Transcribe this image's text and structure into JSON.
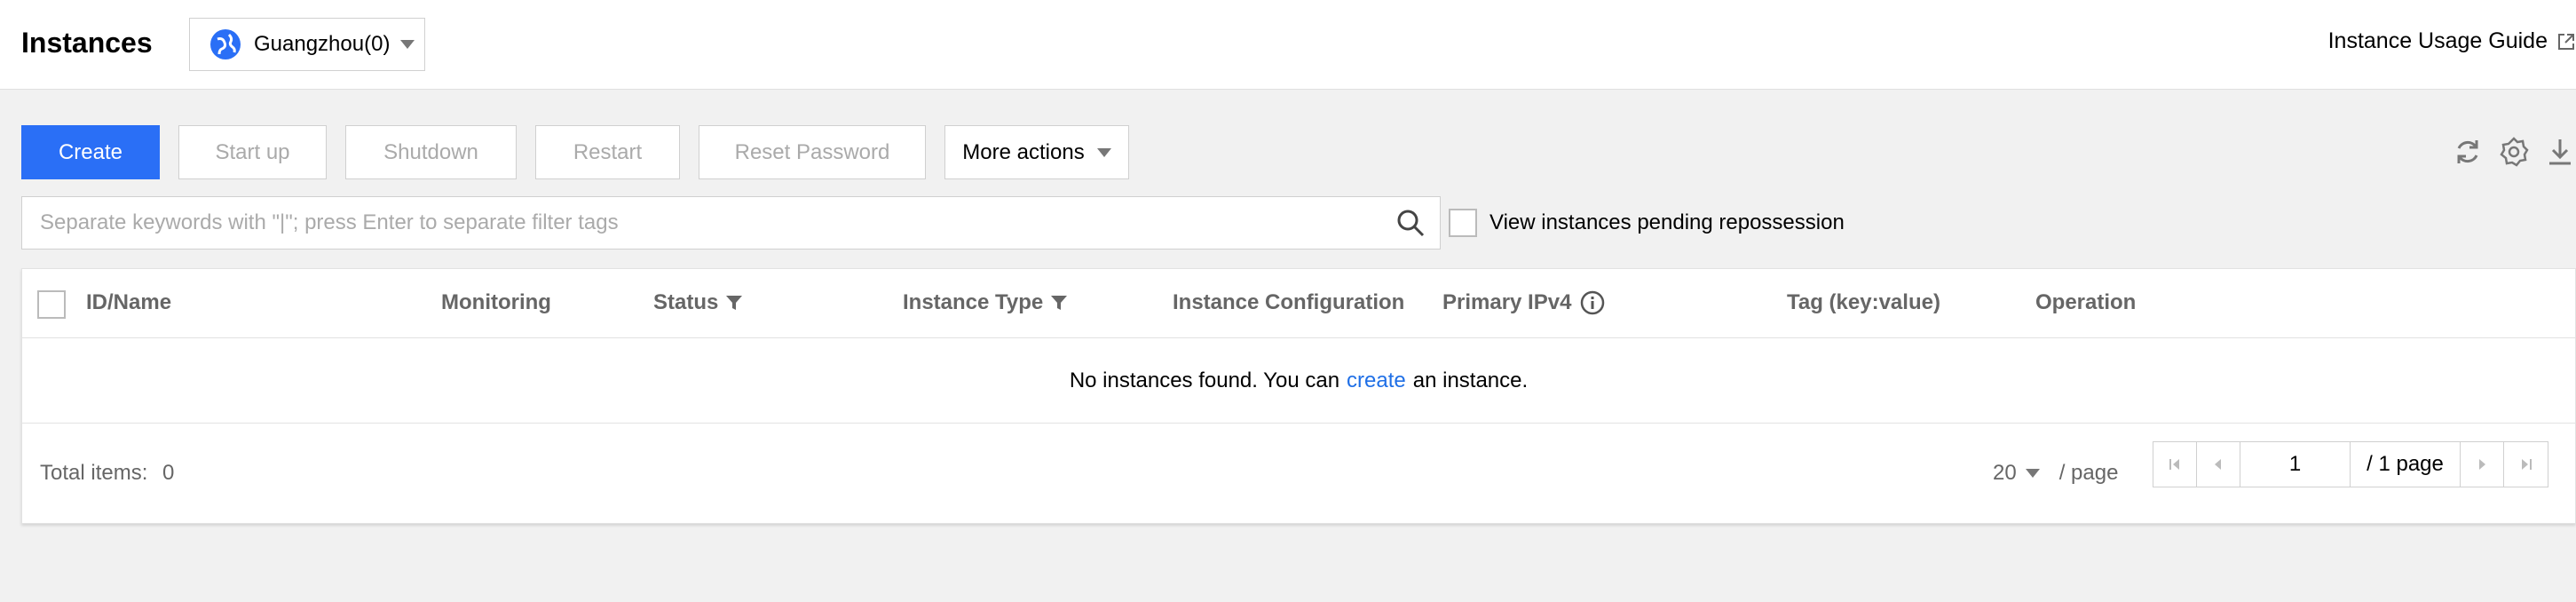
{
  "header": {
    "title": "Instances",
    "region": "Guangzhou(0)",
    "guide_link": "Instance Usage Guide"
  },
  "toolbar": {
    "create": "Create",
    "start_up": "Start up",
    "shutdown": "Shutdown",
    "restart": "Restart",
    "reset_password": "Reset Password",
    "more_actions": "More actions",
    "icons": [
      "refresh-icon",
      "settings-icon",
      "download-icon"
    ]
  },
  "search": {
    "placeholder": "Separate keywords with \"|\"; press Enter to separate filter tags",
    "value": ""
  },
  "pending_repossession": {
    "label": "View instances pending repossession",
    "checked": false
  },
  "table": {
    "columns": {
      "id_name": "ID/Name",
      "monitoring": "Monitoring",
      "status": "Status",
      "instance_type": "Instance Type",
      "instance_configuration": "Instance Configuration",
      "primary_ipv4": "Primary IPv4",
      "tag": "Tag (key:value)",
      "operation": "Operation"
    },
    "empty": {
      "prefix": "No instances found. You can",
      "link": "create",
      "suffix": "an instance."
    }
  },
  "footer": {
    "total_label": "Total items:",
    "total_value": "0",
    "page_size": "20",
    "per_page": "/ page",
    "current_page": "1",
    "total_pages": "/ 1 page"
  },
  "colors": {
    "primary": "#2a6ff6",
    "link": "#1f6fe6",
    "background": "#f1f1f1"
  }
}
